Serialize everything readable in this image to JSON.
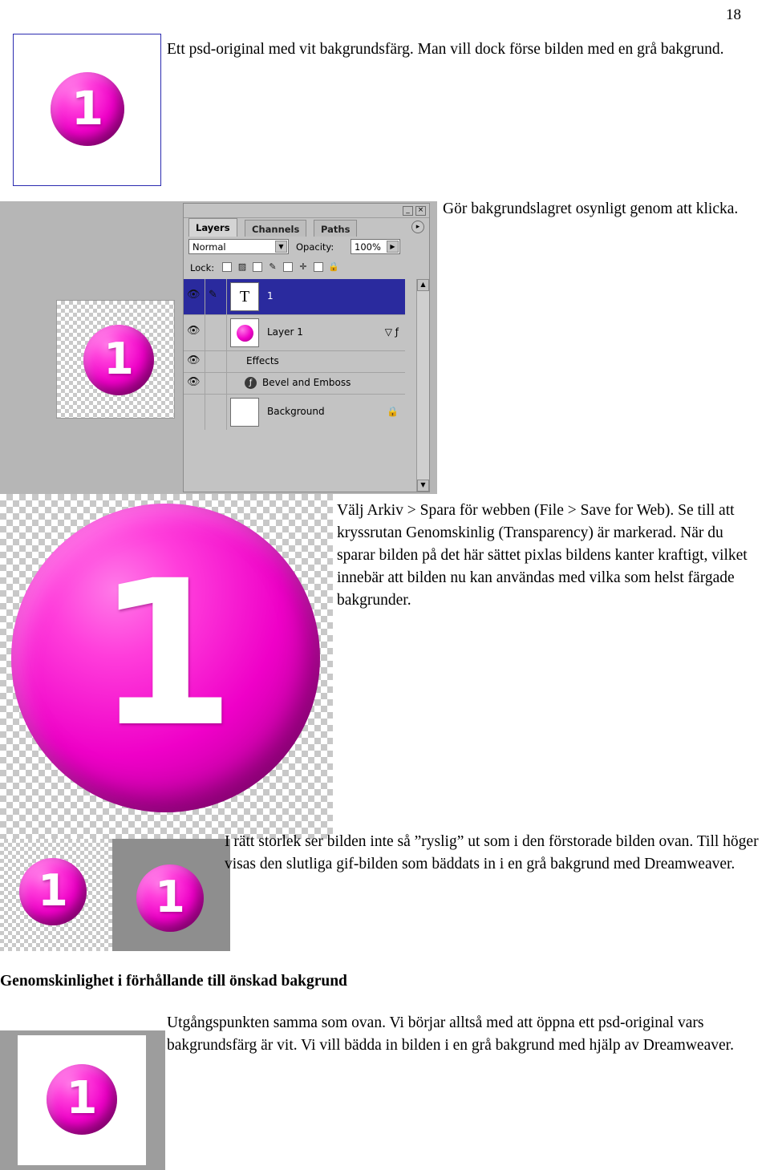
{
  "page": {
    "number": "18"
  },
  "paragraphs": {
    "p1": "Ett psd-original med vit bakgrundsfärg. Man vill dock förse bilden med en grå bakgrund.",
    "p2": "Gör bakgrundslagret osynligt genom att klicka.",
    "p3": "Välj Arkiv > Spara för webben (File > Save for Web). Se till att kryssrutan Genomskinlig (Transparency) är markerad. När du sparar bilden på det här sättet pixlas bildens kanter kraftigt, vilket innebär att bilden nu kan användas med vilka som helst färgade bakgrunder.",
    "p4": "I rätt storlek ser bilden inte så ”ryslig” ut som i den förstorade bilden ovan. Till höger visas den slutliga gif-bilden som bäddats in i en grå bakgrund med Dreamweaver.",
    "heading": "Genomskinlighet i förhållande till önskad bakgrund",
    "p5": "Utgångspunkten samma som ovan. Vi börjar alltså med att öppna ett psd-original vars bakgrundsfärg är vit. Vi vill bädda in bilden i en grå bakgrund med hjälp av Dreamweaver."
  },
  "figures": {
    "original_label": "1",
    "layers_thumb_label": "1",
    "big_label": "1",
    "small_checker_label": "1",
    "small_grey_label": "1",
    "bottom_label": "1"
  },
  "layers_palette": {
    "window_buttons": {
      "minimize": "_",
      "close": "×"
    },
    "tabs": [
      {
        "label": "Layers",
        "active": true
      },
      {
        "label": "Channels",
        "active": false
      },
      {
        "label": "Paths",
        "active": false
      }
    ],
    "menu_glyph": "▸",
    "blend_mode": "Normal",
    "blend_arrow": "▼",
    "opacity_label": "Opacity:",
    "opacity_value": "100%",
    "opacity_arrow": "▶",
    "lock_label": "Lock:",
    "lock_icons": [
      "▨",
      "✎",
      "✛",
      "🔒"
    ],
    "rows": [
      {
        "name": "1",
        "type": "text-layer",
        "thumb_glyph": "T",
        "selected": true,
        "eye": "👁",
        "pen": "✎",
        "extra": ""
      },
      {
        "name": "Layer 1",
        "type": "pixel-layer",
        "selected": false,
        "eye": "👁",
        "pen": "",
        "extra": "▽ ƒ"
      },
      {
        "name": "Effects",
        "type": "effects-group",
        "selected": false,
        "eye": "👁",
        "pen": "",
        "extra": ""
      },
      {
        "name": "Bevel and Emboss",
        "type": "effect-item",
        "selected": false,
        "eye": "👁",
        "pen": "",
        "extra": ""
      },
      {
        "name": "Background",
        "type": "background-layer",
        "selected": false,
        "eye": "",
        "pen": "",
        "extra": "🔒"
      }
    ],
    "scroll_up": "▲",
    "scroll_down": "▼"
  },
  "colors": {
    "accent_pink": "#ef00c8",
    "palette_bg": "#c3c3c3",
    "selection_blue": "#2a2a9e",
    "grey_bg": "#b6b6b6",
    "grey_inset": "#8e8e8e"
  }
}
